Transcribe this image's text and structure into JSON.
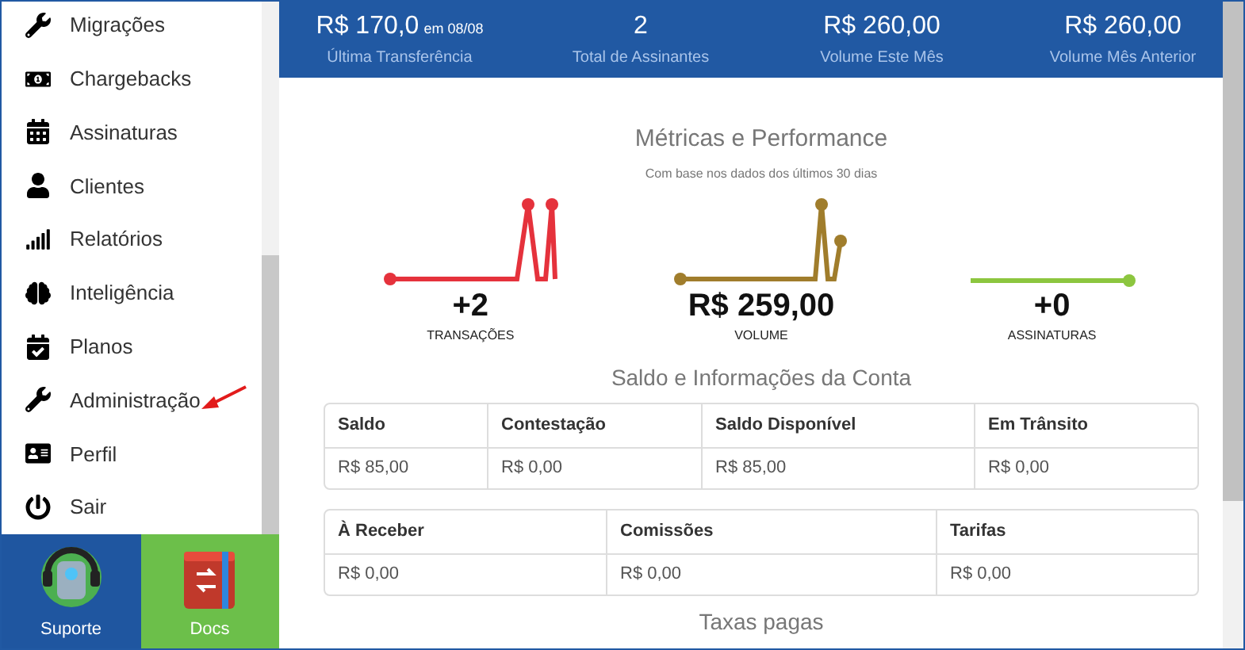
{
  "sidebar": {
    "items": [
      {
        "label": "Migrações"
      },
      {
        "label": "Chargebacks"
      },
      {
        "label": "Assinaturas"
      },
      {
        "label": "Clientes"
      },
      {
        "label": "Relatórios"
      },
      {
        "label": "Inteligência"
      },
      {
        "label": "Planos"
      },
      {
        "label": "Administração"
      },
      {
        "label": "Perfil"
      },
      {
        "label": "Sair"
      }
    ],
    "shortcuts": [
      {
        "label": "Suporte",
        "kind": "support"
      },
      {
        "label": "Docs",
        "kind": "docs"
      }
    ]
  },
  "summary": [
    {
      "value": "R$ 170,0",
      "note": "em 08/08",
      "label": "Última Transferência"
    },
    {
      "value": "2",
      "label": "Total de Assinantes"
    },
    {
      "value": "R$ 260,00",
      "label": "Volume Este Mês"
    },
    {
      "value": "R$ 260,00",
      "label": "Volume Mês Anterior"
    }
  ],
  "metrics": {
    "title": "Métricas e Performance",
    "subtitle": "Com base nos dados dos últimos 30 dias",
    "items": [
      {
        "value": "+2",
        "label": "TRANSAÇÕES",
        "color": "#e5323c"
      },
      {
        "value": "R$ 259,00",
        "label": "VOLUME",
        "color": "#a07d2c"
      },
      {
        "value": "+0",
        "label": "ASSINATURAS",
        "color": "#8cc63f"
      }
    ]
  },
  "account": {
    "title": "Saldo e Informações da Conta",
    "tables": [
      {
        "columns": [
          "Saldo",
          "Contestação",
          "Saldo Disponível",
          "Em Trânsito"
        ],
        "values": [
          "R$ 85,00",
          "R$ 0,00",
          "R$ 85,00",
          "R$ 0,00"
        ]
      },
      {
        "columns": [
          "À Receber",
          "Comissões",
          "Tarifas"
        ],
        "values": [
          "R$ 0,00",
          "R$ 0,00",
          "R$ 0,00"
        ]
      }
    ]
  },
  "next_section": {
    "title": "Taxas pagas"
  }
}
